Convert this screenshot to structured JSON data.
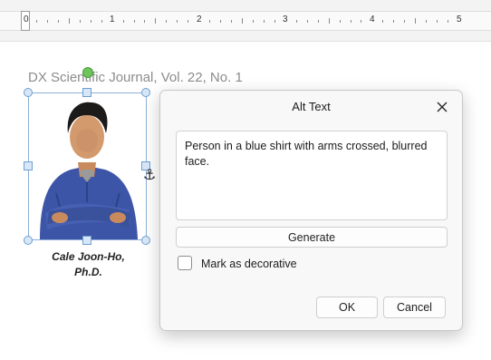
{
  "ruler": {
    "numbers": [
      "0",
      "1",
      "2",
      "3",
      "4",
      "5"
    ]
  },
  "document": {
    "header": "DX Scientific Journal, Vol. 22, No. 1",
    "caption_line1": "Cale Joon-Ho,",
    "caption_line2": "Ph.D."
  },
  "dialog": {
    "title": "Alt Text",
    "alt_text_value": "Person in a blue shirt with arms crossed, blurred face.",
    "generate_label": "Generate",
    "decorative_label": "Mark as decorative",
    "decorative_checked": false,
    "ok_label": "OK",
    "cancel_label": "Cancel"
  },
  "icons": {
    "close": "close-icon",
    "anchor": "anchor-icon",
    "rotate": "rotate-handle-icon"
  },
  "colors": {
    "selection_border": "#8ab0d8",
    "rotate_handle": "#6fc45c",
    "shirt": "#3d55a6"
  }
}
